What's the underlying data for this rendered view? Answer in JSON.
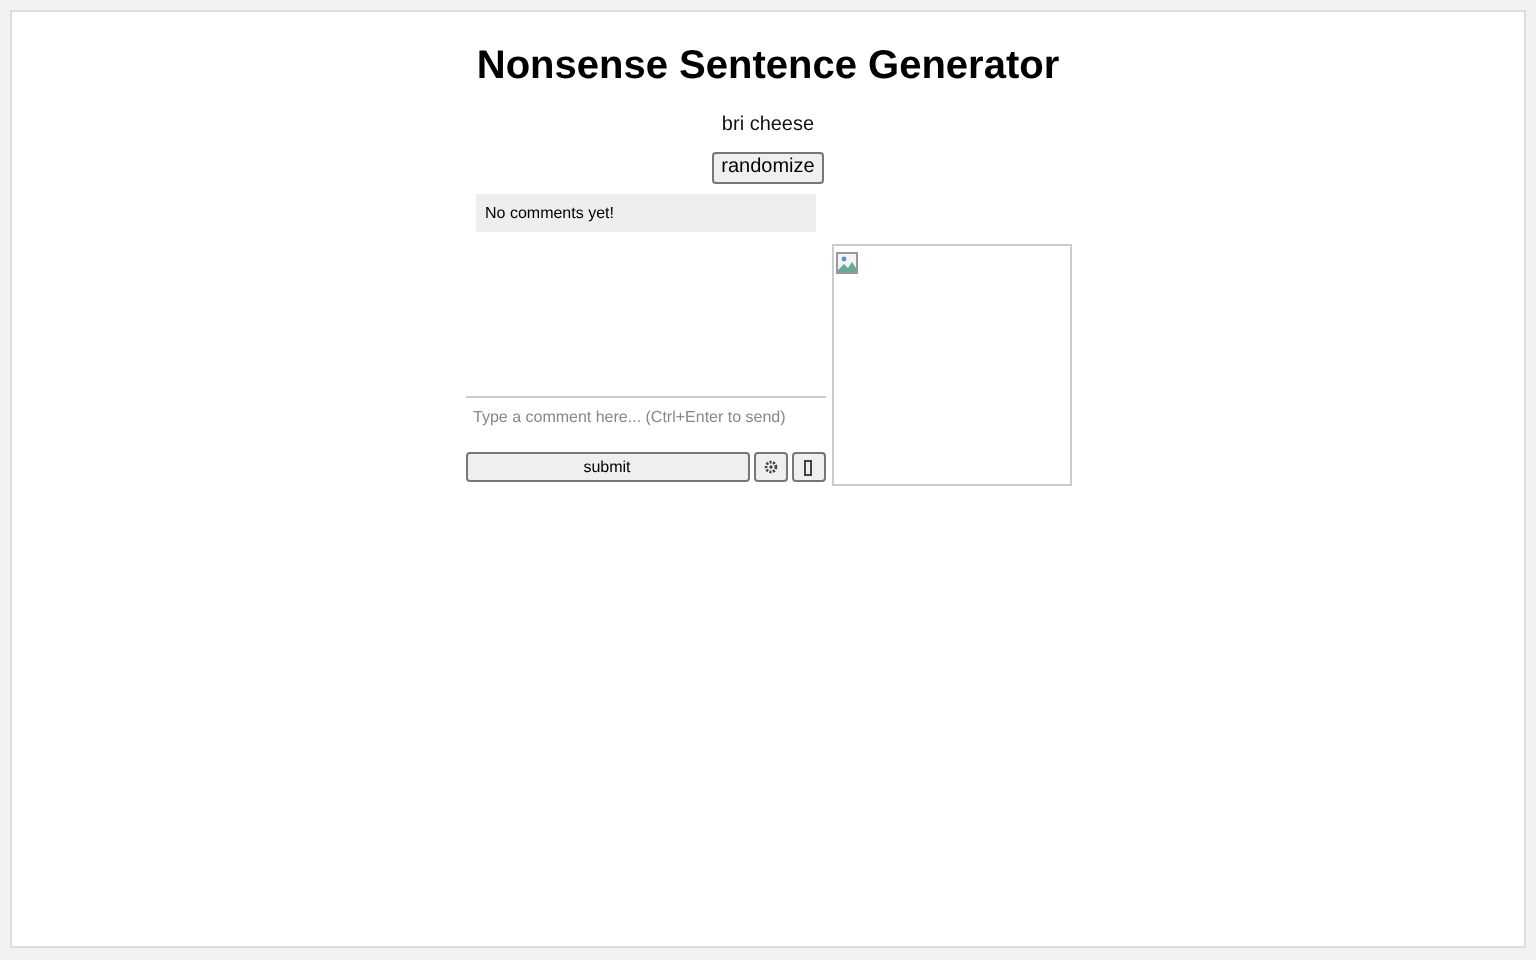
{
  "title": "Nonsense Sentence Generator",
  "sentence": "bri cheese",
  "randomize_button": "randomize",
  "comments": {
    "empty_message": "No comments yet!",
    "placeholder": "Type a comment here... (Ctrl+Enter to send)"
  },
  "buttons": [
    {
      "kind": "text",
      "label": "submit"
    },
    {
      "kind": "gear"
    },
    {
      "kind": "box"
    }
  ],
  "image": {
    "kind": "picture",
    "broken": true
  }
}
